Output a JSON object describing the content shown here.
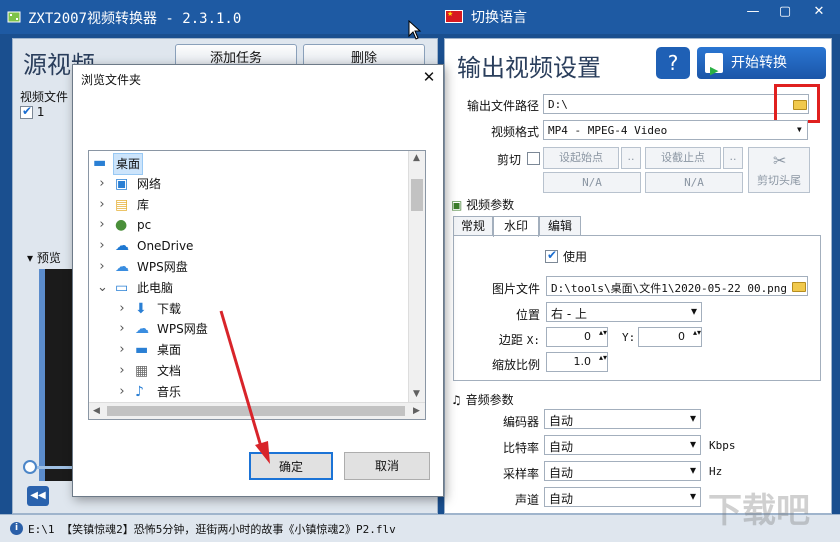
{
  "window": {
    "title": "ZXT2007视频转换器 - 2.3.1.0",
    "language_label": "切换语言",
    "colors": {
      "titlebar": "#1e5aa3",
      "accent": "#1f60b5",
      "highlight": "#e0201f"
    }
  },
  "left": {
    "source_title": "源视频",
    "add_task_label": "添加任务",
    "delete_label": "删除",
    "file_list_label": "视频文件",
    "file_row_text": "1",
    "preview_label": "预览"
  },
  "right": {
    "output_title": "输出视频设置",
    "help_label": "?",
    "start_label": "开始转换",
    "output_path_label": "输出文件路径",
    "output_path_value": "D:\\",
    "format_label": "视频格式",
    "format_value": "MP4 - MPEG-4 Video",
    "cut_label": "剪切",
    "set_start_label": "设起始点",
    "set_end_label": "设截止点",
    "ellipsis": "..",
    "start_time": "N/A",
    "end_time": "N/A",
    "cut_head_label": "剪切头尾",
    "video_params_label": "视频参数",
    "tabs": [
      {
        "label": "常规"
      },
      {
        "label": "水印"
      },
      {
        "label": "编辑"
      }
    ],
    "watermark_enable_label": "使用",
    "image_file_label": "图片文件",
    "image_file_value": "D:\\tools\\桌面\\文件1\\2020-05-22 00.png",
    "position_label": "位置",
    "position_value": "右 - 上",
    "margin_label": "边距",
    "margin_x_label": "X:",
    "margin_x_value": "0",
    "margin_y_label": "Y:",
    "margin_y_value": "0",
    "scale_label": "缩放比例",
    "scale_value": "1.0",
    "audio_params_label": "音频参数",
    "encoder_label": "编码器",
    "encoder_value": "自动",
    "bitrate_label": "比特率",
    "bitrate_value": "自动",
    "bitrate_unit": "Kbps",
    "samplerate_label": "采样率",
    "samplerate_value": "自动",
    "samplerate_unit": "Hz",
    "channel_label": "声道",
    "channel_value": "自动"
  },
  "dialog": {
    "title": "浏览文件夹",
    "close_glyph": "✕",
    "ok_label": "确定",
    "cancel_label": "取消",
    "tree": [
      {
        "label": "桌面",
        "icon": "desktop-icon",
        "selected": true
      },
      {
        "label": "网络",
        "icon": "network-icon"
      },
      {
        "label": "库",
        "icon": "library-icon"
      },
      {
        "label": "pc",
        "icon": "user-icon"
      },
      {
        "label": "OneDrive",
        "icon": "onedrive-icon"
      },
      {
        "label": "WPS网盘",
        "icon": "cloud-icon"
      },
      {
        "label": "此电脑",
        "icon": "computer-icon",
        "expanded": true
      },
      {
        "label": "下载",
        "icon": "download-icon"
      },
      {
        "label": "WPS网盘",
        "icon": "cloud-icon"
      },
      {
        "label": "桌面",
        "icon": "desktop-icon"
      },
      {
        "label": "文档",
        "icon": "document-icon"
      },
      {
        "label": "音乐",
        "icon": "music-icon"
      }
    ]
  },
  "status": {
    "text": "E:\\1 【笑镇惊魂2】恐怖5分钟，逛街两小时的故事《小镇惊魂2》P2.flv"
  },
  "watermark_text": "下载吧"
}
